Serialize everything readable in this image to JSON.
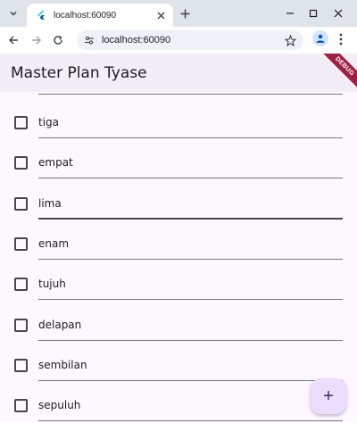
{
  "browser": {
    "tab_title": "localhost:60090",
    "url": "localhost:60090"
  },
  "app": {
    "title": "Master Plan Tyase",
    "debug_banner": "DEBUG",
    "tasks": [
      {
        "label": "tiga",
        "done": false
      },
      {
        "label": "empat",
        "done": false
      },
      {
        "label": "lima",
        "done": false
      },
      {
        "label": "enam",
        "done": false
      },
      {
        "label": "tujuh",
        "done": false
      },
      {
        "label": "delapan",
        "done": false
      },
      {
        "label": "sembilan",
        "done": false
      },
      {
        "label": "sepuluh",
        "done": false
      }
    ],
    "fab_label": "+"
  },
  "colors": {
    "appbar": "#f3edf7",
    "background": "#fdf7ff",
    "fab": "#eaddff",
    "debug_ribbon": "#a02041"
  },
  "icons": [
    "tab-search-icon",
    "flutter-favicon-icon",
    "close-icon",
    "new-tab-icon",
    "minimize-icon",
    "maximize-icon",
    "window-close-icon",
    "back-icon",
    "forward-icon",
    "reload-icon",
    "site-info-icon",
    "bookmark-star-icon",
    "profile-icon",
    "menu-icon",
    "add-icon"
  ]
}
